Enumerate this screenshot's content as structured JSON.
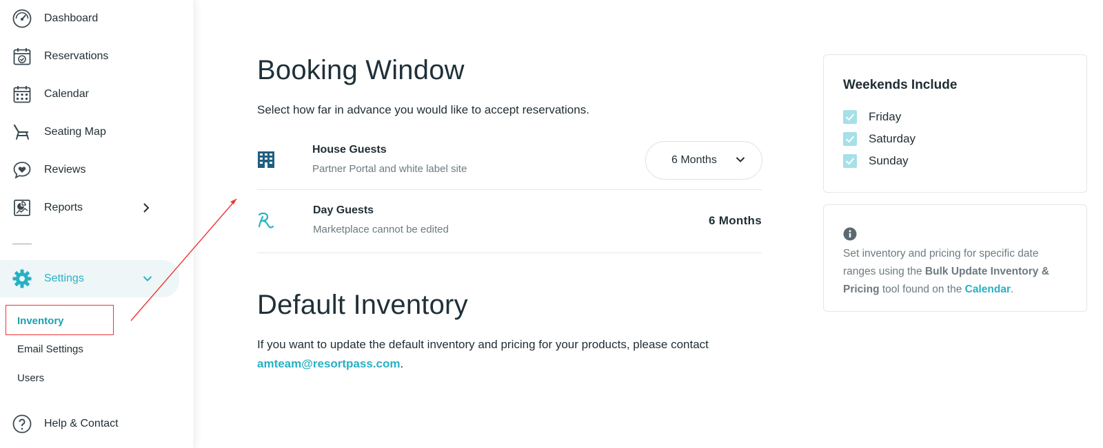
{
  "sidebar": {
    "items": [
      {
        "label": "Dashboard",
        "icon": "speedometer-icon"
      },
      {
        "label": "Reservations",
        "icon": "calendar-check-icon"
      },
      {
        "label": "Calendar",
        "icon": "calendar-icon"
      },
      {
        "label": "Seating Map",
        "icon": "lounge-chair-icon"
      },
      {
        "label": "Reviews",
        "icon": "heart-chat-icon"
      },
      {
        "label": "Reports",
        "icon": "report-chart-icon"
      }
    ],
    "settings": {
      "label": "Settings",
      "icon": "gear-icon"
    },
    "sub_items": [
      "Inventory",
      "Email Settings",
      "Users"
    ],
    "help": {
      "label": "Help & Contact",
      "icon": "question-icon"
    }
  },
  "booking": {
    "title": "Booking Window",
    "description": "Select how far in advance you would like to accept reservations.",
    "house": {
      "title": "House Guests",
      "subtitle": "Partner Portal and white label site",
      "selected": "6 Months"
    },
    "day": {
      "title": "Day Guests",
      "subtitle": "Marketplace cannot be edited",
      "value": "6 Months"
    }
  },
  "inventory": {
    "title": "Default Inventory",
    "text": "If you want to update the default inventory and pricing for your products, please contact",
    "email": "amteam@resortpass.com",
    "period": "."
  },
  "weekends": {
    "title": "Weekends Include",
    "days": [
      "Friday",
      "Saturday",
      "Sunday"
    ]
  },
  "info": {
    "text1": "Set inventory and pricing for specific date ranges using the ",
    "bold": "Bulk Update Inventory & Pricing",
    "text2": " tool found on the ",
    "link": "Calendar",
    "text3": "."
  },
  "colors": {
    "accent": "#27b1c4",
    "checkbox": "#a6e0e8",
    "annotation": "#ee3333"
  }
}
